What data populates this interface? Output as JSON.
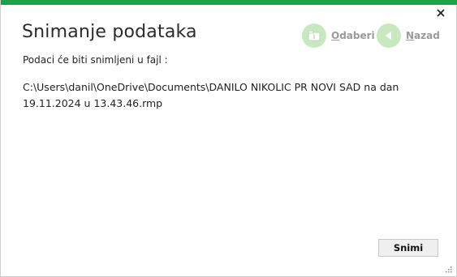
{
  "dialog": {
    "title": "Snimanje podataka",
    "subtitle": "Podaci će biti snimljeni u  fajl :",
    "file_path": "C:\\Users\\danil\\OneDrive\\Documents\\DANILO NIKOLIC PR NOVI SAD na dan 19.11.2024 u 13.43.46.rmp",
    "close_icon": "close-icon"
  },
  "toolbar": {
    "choose": {
      "first": "O",
      "rest": "daberi",
      "icon": "folder-icon"
    },
    "back": {
      "first": "N",
      "rest": "azad",
      "icon": "back-arrow-icon"
    }
  },
  "footer": {
    "save_label": "Snimi"
  },
  "colors": {
    "accent": "#1aa34a",
    "icon_bg": "#c8e9c0",
    "disabled_text": "#9a9a9a"
  }
}
